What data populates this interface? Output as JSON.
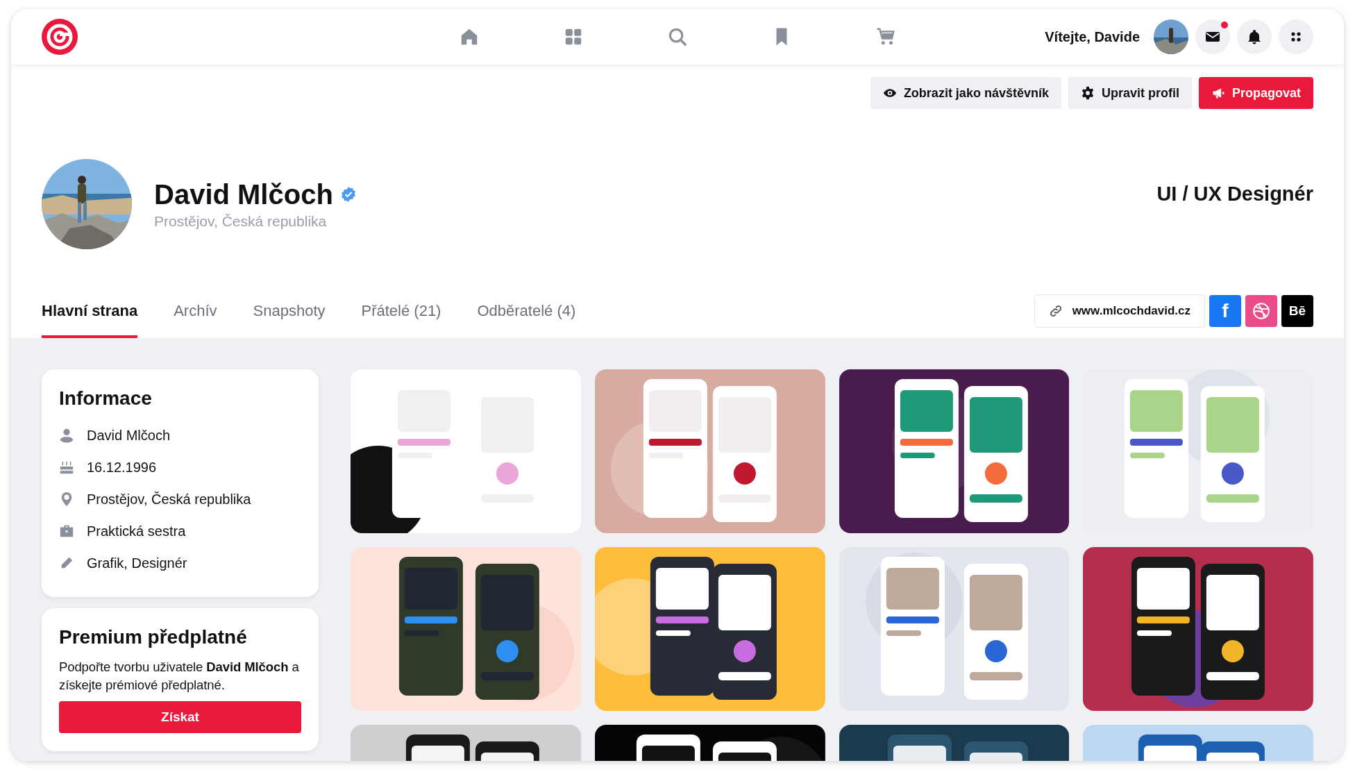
{
  "header": {
    "greeting": "Vítejte, Davide",
    "icons": [
      {
        "kind": "mail",
        "badge": true
      },
      {
        "kind": "bell",
        "badge": false
      },
      {
        "kind": "apps",
        "badge": false
      }
    ]
  },
  "actions": [
    {
      "kind": "view",
      "label": "Zobrazit jako návštěvník"
    },
    {
      "kind": "edit",
      "label": "Upravit profil"
    },
    {
      "kind": "promote",
      "label": "Propagovat"
    }
  ],
  "profile": {
    "name": "David Mlčoch",
    "verified": true,
    "location": "Prostějov, Česká republika",
    "role": "UI / UX Designér"
  },
  "tabs": [
    {
      "label": "Hlavní strana",
      "selected": true
    },
    {
      "label": "Archív",
      "selected": false
    },
    {
      "label": "Snapshoty",
      "selected": false
    },
    {
      "label": "Přátelé (21)",
      "selected": false
    },
    {
      "label": "Odběratelé (4)",
      "selected": false
    }
  ],
  "website": "www.mlcochdavid.cz",
  "social": [
    {
      "kind": "facebook",
      "label": "f"
    },
    {
      "kind": "dribbble"
    },
    {
      "kind": "behance",
      "label": "Bē"
    }
  ],
  "info": {
    "title": "Informace",
    "items": [
      {
        "kind": "person",
        "text": "David Mlčoch"
      },
      {
        "kind": "birthday",
        "text": "16.12.1996"
      },
      {
        "kind": "location",
        "text": "Prostějov, Česká republika"
      },
      {
        "kind": "work",
        "text": "Praktická sestra"
      },
      {
        "kind": "skill",
        "text": "Grafik, Designér"
      }
    ]
  },
  "premium": {
    "title": "Premium předplatné",
    "text": "Podpořte tvorbu uživatele **David Mlčoch** a získejte prémiové předplatné.",
    "button": "Získat"
  }
}
